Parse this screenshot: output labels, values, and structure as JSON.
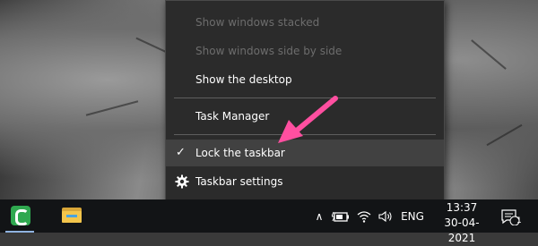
{
  "context_menu": {
    "items": [
      {
        "label": "Show windows stacked",
        "enabled": false
      },
      {
        "label": "Show windows side by side",
        "enabled": false
      },
      {
        "label": "Show the desktop",
        "enabled": true
      },
      {
        "label": "Task Manager",
        "enabled": true
      },
      {
        "label": "Lock the taskbar",
        "enabled": true,
        "checked": true,
        "hovered": true
      },
      {
        "label": "Taskbar settings",
        "enabled": true,
        "icon": "gear-icon"
      }
    ],
    "check_glyph": "✓"
  },
  "taskbar": {
    "apps": [
      {
        "name": "camtasia-icon",
        "running": true
      },
      {
        "name": "file-explorer-icon",
        "running": false
      }
    ],
    "tray": {
      "chevron": "∧",
      "language": "ENG",
      "time": "13:37",
      "date": "30-04-2021",
      "notification_count": "1"
    }
  },
  "annotation": {
    "color": "#ff4fa0"
  },
  "colors": {
    "menu_bg": "#2b2b2b",
    "menu_hover": "#414141",
    "taskbar_bg": "#121416",
    "disabled_text": "#6d6d6d"
  }
}
